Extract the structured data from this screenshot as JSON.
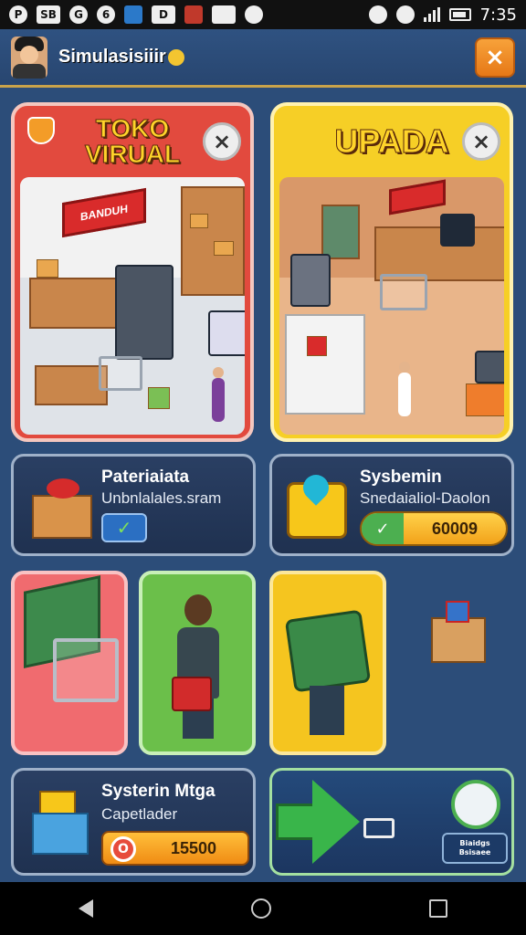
{
  "status_bar": {
    "time": "7:35",
    "icons": [
      "notification-icon",
      "app-icon",
      "sync-icon",
      "bluetooth-icon",
      "shield-icon",
      "app-icon",
      "store-icon",
      "camera-icon",
      "settings-icon"
    ],
    "icon_texts": [
      "P",
      "SB",
      "G",
      "6",
      "",
      "D",
      "",
      "",
      ""
    ]
  },
  "header": {
    "title": "Simulasisiiir",
    "close_label": "×"
  },
  "cards": {
    "toko_virual": {
      "title_line1": "TOKO",
      "title_line2": "VIRUAL",
      "sign_text": "BANDUH",
      "close_label": "×"
    },
    "upada": {
      "title": "UPADA",
      "close_label": "×"
    }
  },
  "mid_cards": {
    "left": {
      "title": "Pateriaiata",
      "subtitle": "Unbnlalales.sram",
      "check_label": "✓"
    },
    "right": {
      "title": "Sysbemin",
      "subtitle": "Snedaialiol-Daolon",
      "badge_label": "✓",
      "value": "60009"
    }
  },
  "bottom_cards": {
    "left": {
      "title": "Systerin Mtga",
      "subtitle": "Capetlader",
      "coin_label": "O",
      "value": "15500"
    },
    "right": {
      "button_line1": "Biaidgs",
      "button_line2": "Bsisaee"
    }
  },
  "nav": {
    "back": "back-icon",
    "home": "home-icon",
    "recent": "recent-apps-icon"
  },
  "colors": {
    "background": "#2c4d79",
    "accent_orange": "#f08c14",
    "card_red": "#e24a3e",
    "card_yellow": "#f6cf26",
    "tile_green": "#6bbf4a",
    "tile_pink": "#f06b6f"
  }
}
